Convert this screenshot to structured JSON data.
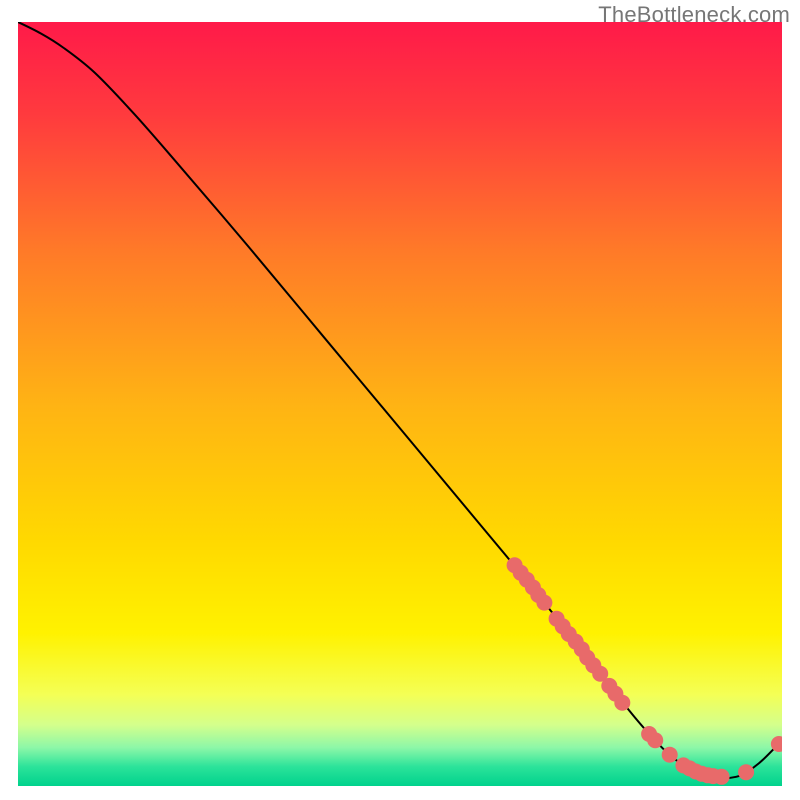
{
  "watermark": "TheBottleneck.com",
  "chart_data": {
    "type": "line",
    "title": "",
    "xlabel": "",
    "ylabel": "",
    "xlim": [
      0,
      100
    ],
    "ylim": [
      0,
      100
    ],
    "gradient_stops": [
      {
        "offset": 0.0,
        "color": "#ff1a49"
      },
      {
        "offset": 0.12,
        "color": "#ff3a3e"
      },
      {
        "offset": 0.3,
        "color": "#ff7a28"
      },
      {
        "offset": 0.5,
        "color": "#ffb314"
      },
      {
        "offset": 0.68,
        "color": "#ffd900"
      },
      {
        "offset": 0.8,
        "color": "#fff200"
      },
      {
        "offset": 0.88,
        "color": "#f4ff55"
      },
      {
        "offset": 0.92,
        "color": "#d4ff8c"
      },
      {
        "offset": 0.95,
        "color": "#8cf7a8"
      },
      {
        "offset": 0.975,
        "color": "#2be39a"
      },
      {
        "offset": 1.0,
        "color": "#00d28c"
      }
    ],
    "series": [
      {
        "name": "bottleneck-curve",
        "color": "#000000",
        "x": [
          0,
          3,
          6,
          10,
          15,
          20,
          30,
          40,
          50,
          60,
          66,
          70,
          74,
          78,
          82,
          86,
          90,
          94,
          97,
          100
        ],
        "y": [
          100,
          98.5,
          96.6,
          93.4,
          88.2,
          82.5,
          70.8,
          58.8,
          46.8,
          34.8,
          27.6,
          22.6,
          17.6,
          12.4,
          7.5,
          3.5,
          1.4,
          1.2,
          3.0,
          6.0
        ]
      }
    ],
    "markers": {
      "name": "highlight-dots",
      "color": "#e86a6a",
      "radius": 8,
      "points": [
        {
          "x": 65.0,
          "y": 28.9
        },
        {
          "x": 65.8,
          "y": 27.9
        },
        {
          "x": 66.6,
          "y": 27.0
        },
        {
          "x": 67.4,
          "y": 26.0
        },
        {
          "x": 68.1,
          "y": 25.0
        },
        {
          "x": 68.9,
          "y": 24.0
        },
        {
          "x": 70.5,
          "y": 21.9
        },
        {
          "x": 71.3,
          "y": 20.9
        },
        {
          "x": 72.1,
          "y": 19.9
        },
        {
          "x": 73.0,
          "y": 18.9
        },
        {
          "x": 73.8,
          "y": 17.9
        },
        {
          "x": 74.5,
          "y": 16.8
        },
        {
          "x": 75.3,
          "y": 15.8
        },
        {
          "x": 76.2,
          "y": 14.7
        },
        {
          "x": 77.4,
          "y": 13.1
        },
        {
          "x": 78.2,
          "y": 12.1
        },
        {
          "x": 79.1,
          "y": 10.9
        },
        {
          "x": 82.6,
          "y": 6.8
        },
        {
          "x": 83.4,
          "y": 6.0
        },
        {
          "x": 85.3,
          "y": 4.1
        },
        {
          "x": 87.1,
          "y": 2.7
        },
        {
          "x": 87.9,
          "y": 2.3
        },
        {
          "x": 88.7,
          "y": 1.9
        },
        {
          "x": 89.5,
          "y": 1.6
        },
        {
          "x": 90.3,
          "y": 1.4
        },
        {
          "x": 91.0,
          "y": 1.3
        },
        {
          "x": 92.1,
          "y": 1.2
        },
        {
          "x": 95.3,
          "y": 1.8
        },
        {
          "x": 99.6,
          "y": 5.5
        }
      ]
    }
  }
}
